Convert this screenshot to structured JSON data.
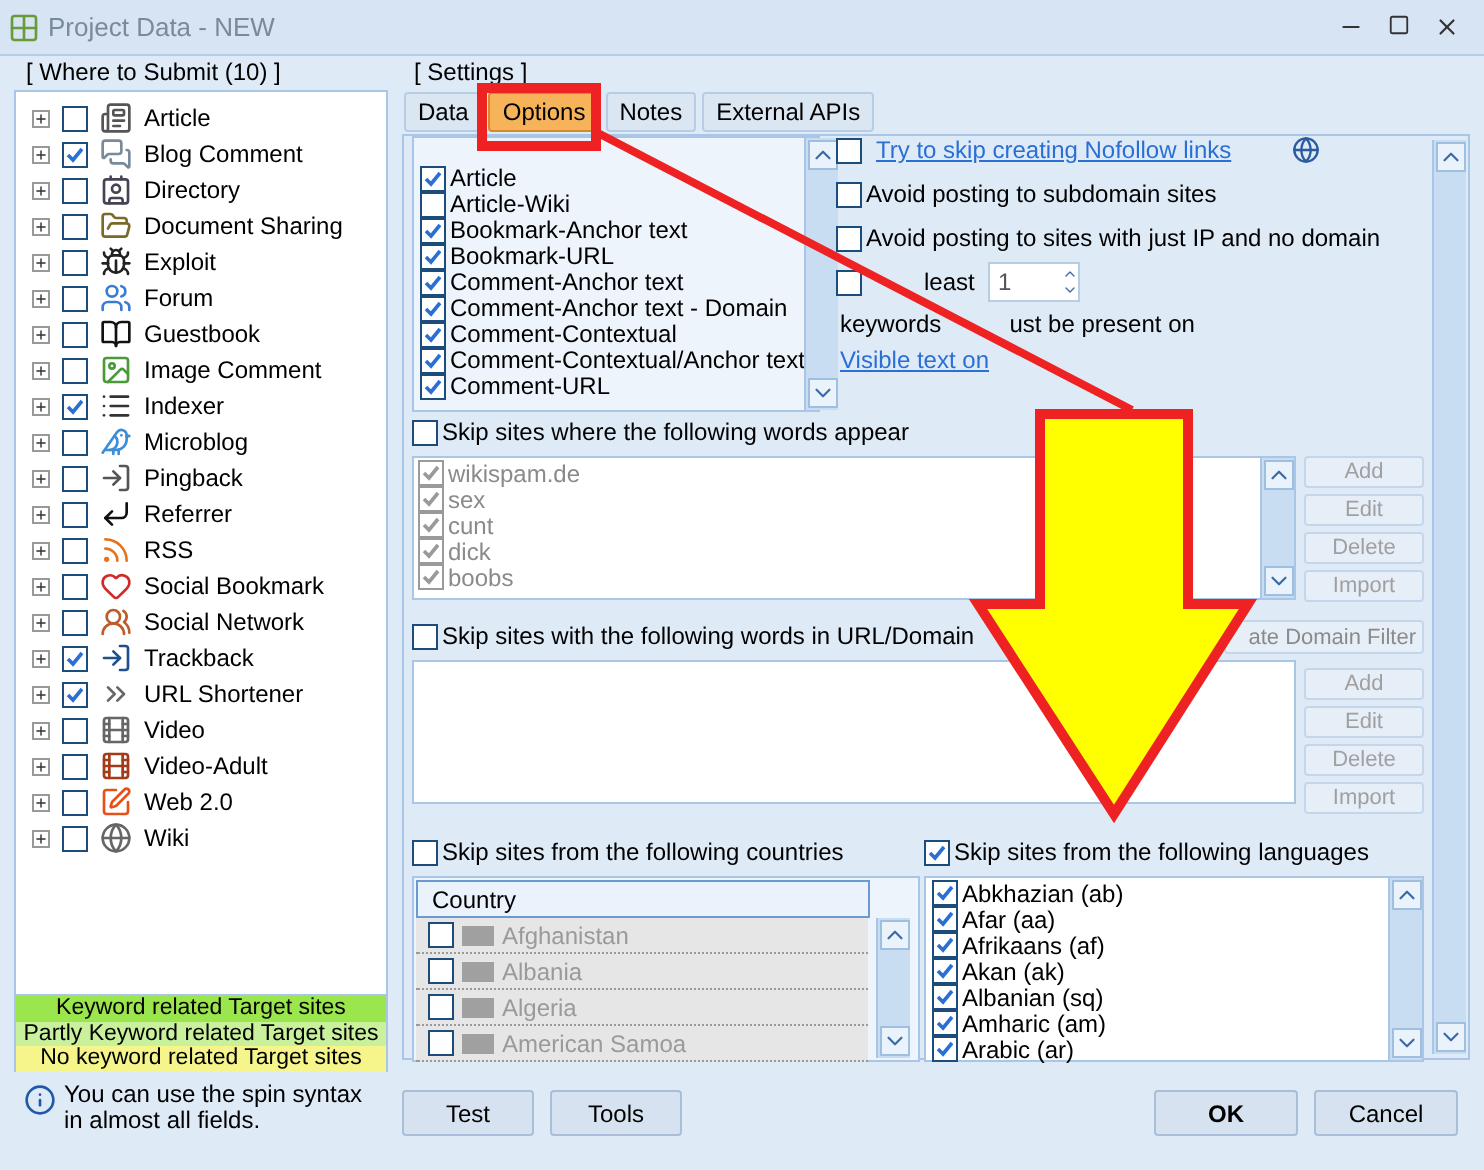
{
  "window": {
    "title": "Project Data - NEW"
  },
  "where_to_submit": {
    "title": "[ Where to Submit  (10) ]",
    "items": [
      {
        "label": "Article",
        "checked": false
      },
      {
        "label": "Blog Comment",
        "checked": true
      },
      {
        "label": "Directory",
        "checked": false
      },
      {
        "label": "Document Sharing",
        "checked": false
      },
      {
        "label": "Exploit",
        "checked": false
      },
      {
        "label": "Forum",
        "checked": false
      },
      {
        "label": "Guestbook",
        "checked": false
      },
      {
        "label": "Image Comment",
        "checked": false
      },
      {
        "label": "Indexer",
        "checked": true
      },
      {
        "label": "Microblog",
        "checked": false
      },
      {
        "label": "Pingback",
        "checked": false
      },
      {
        "label": "Referrer",
        "checked": false
      },
      {
        "label": "RSS",
        "checked": false
      },
      {
        "label": "Social Bookmark",
        "checked": false
      },
      {
        "label": "Social Network",
        "checked": false
      },
      {
        "label": "Trackback",
        "checked": true
      },
      {
        "label": "URL Shortener",
        "checked": true
      },
      {
        "label": "Video",
        "checked": false
      },
      {
        "label": "Video-Adult",
        "checked": false
      },
      {
        "label": "Web 2.0",
        "checked": false
      },
      {
        "label": "Wiki",
        "checked": false
      }
    ]
  },
  "legend": [
    {
      "label": "Keyword related Target sites",
      "color": "#9be64d"
    },
    {
      "label": "Partly Keyword related Target sites",
      "color": "#c9f09b"
    },
    {
      "label": "No keyword related Target sites",
      "color": "#f5f58c"
    }
  ],
  "hint": "You can use the spin syntax in almost all fields.",
  "settings": {
    "title": "[ Settings ]",
    "tabs": [
      {
        "label": "Data",
        "selected": false
      },
      {
        "label": "Options",
        "selected": true
      },
      {
        "label": "Notes",
        "selected": false
      },
      {
        "label": "External APIs",
        "selected": false
      }
    ],
    "engines": [
      {
        "label": "Article",
        "checked": true
      },
      {
        "label": "Article-Wiki",
        "checked": false
      },
      {
        "label": "Bookmark-Anchor text",
        "checked": true
      },
      {
        "label": "Bookmark-URL",
        "checked": true
      },
      {
        "label": "Comment-Anchor text",
        "checked": true
      },
      {
        "label": "Comment-Anchor text - Domain",
        "checked": true
      },
      {
        "label": "Comment-Contextual",
        "checked": true
      },
      {
        "label": "Comment-Contextual/Anchor text",
        "checked": true
      },
      {
        "label": "Comment-URL",
        "checked": true
      }
    ],
    "nofollow": {
      "label": "Try to skip creating Nofollow links",
      "checked": false
    },
    "options": [
      {
        "label": "Avoid posting to subdomain sites",
        "checked": false
      },
      {
        "label": "Avoid posting to sites with just IP and no domain",
        "checked": false
      }
    ],
    "at_least": {
      "label": "least",
      "checked": false,
      "value": "1"
    },
    "keywords_note": [
      "keywords",
      "ust be present on"
    ],
    "visible_link": "Visible text on",
    "skip_words": {
      "label": "Skip sites where the following words appear",
      "checked": false,
      "words": [
        {
          "text": "wikispam.de",
          "checked": true
        },
        {
          "text": "sex",
          "checked": true
        },
        {
          "text": "cunt",
          "checked": true
        },
        {
          "text": "dick",
          "checked": true
        },
        {
          "text": "boobs",
          "checked": true
        }
      ],
      "buttons": [
        "Add",
        "Edit",
        "Delete",
        "Import"
      ]
    },
    "skip_url": {
      "label": "Skip sites with the following words in URL/Domain",
      "checked": false,
      "filter_button": "ate Domain Filter",
      "buttons": [
        "Add",
        "Edit",
        "Delete",
        "Import"
      ]
    },
    "countries": {
      "label": "Skip sites from the following countries",
      "checked": false,
      "column": "Country",
      "rows": [
        {
          "name": "Afghanistan",
          "checked": false
        },
        {
          "name": "Albania",
          "checked": false
        },
        {
          "name": "Algeria",
          "checked": false
        },
        {
          "name": "American Samoa",
          "checked": false
        }
      ]
    },
    "languages": {
      "label": "Skip sites from the following languages",
      "checked": true,
      "rows": [
        {
          "name": "Abkhazian (ab)",
          "checked": true
        },
        {
          "name": "Afar (aa)",
          "checked": true
        },
        {
          "name": "Afrikaans (af)",
          "checked": true
        },
        {
          "name": "Akan (ak)",
          "checked": true
        },
        {
          "name": "Albanian (sq)",
          "checked": true
        },
        {
          "name": "Amharic (am)",
          "checked": true
        },
        {
          "name": "Arabic (ar)",
          "checked": true
        }
      ]
    }
  },
  "buttons": {
    "left": [
      "Test",
      "Tools"
    ],
    "ok": "OK",
    "cancel": "Cancel"
  }
}
